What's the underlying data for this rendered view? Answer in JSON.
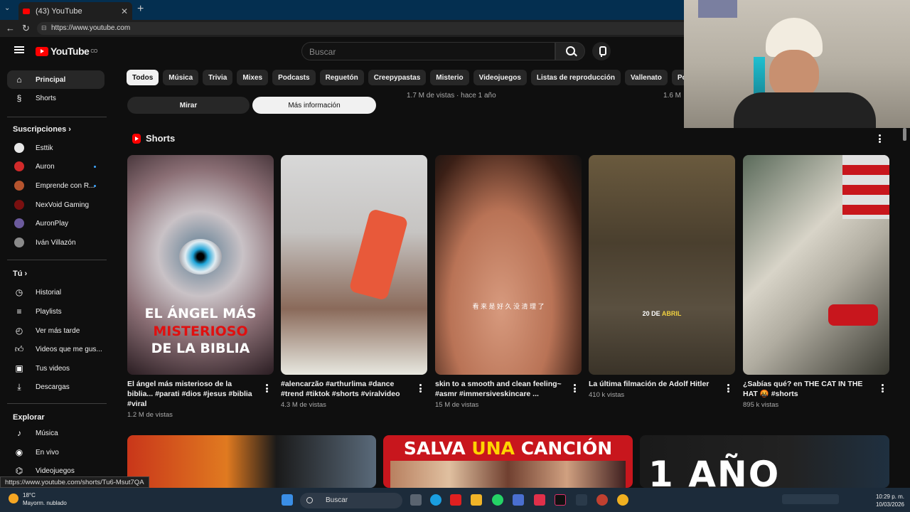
{
  "browser": {
    "tab_title": "(43) YouTube",
    "url": "https://www.youtube.com",
    "status_url": "https://www.youtube.com/shorts/Tu6-Msut7QA"
  },
  "header": {
    "logo_text": "YouTube",
    "country_code": "CO",
    "search_placeholder": "Buscar"
  },
  "sidebar": {
    "main": [
      {
        "label": "Principal",
        "icon": "home-icon"
      },
      {
        "label": "Shorts",
        "icon": "shorts-icon"
      }
    ],
    "subscriptions_heading": "Suscripciones",
    "subscriptions": [
      {
        "label": "Esttik"
      },
      {
        "label": "Auron"
      },
      {
        "label": "Emprende con R..."
      },
      {
        "label": "NexVoid Gaming"
      },
      {
        "label": "AuronPlay"
      },
      {
        "label": "Iván Villazón"
      }
    ],
    "you_heading": "Tú",
    "you_items": [
      {
        "label": "Historial",
        "icon": "history-icon"
      },
      {
        "label": "Playlists",
        "icon": "playlists-icon"
      },
      {
        "label": "Ver más tarde",
        "icon": "clock-icon"
      },
      {
        "label": "Videos que me gus...",
        "icon": "thumbs-up-icon"
      },
      {
        "label": "Tus videos",
        "icon": "video-icon"
      },
      {
        "label": "Descargas",
        "icon": "download-icon"
      }
    ],
    "explore_heading": "Explorar",
    "explore_items": [
      {
        "label": "Música",
        "icon": "music-icon"
      },
      {
        "label": "En vivo",
        "icon": "live-icon"
      },
      {
        "label": "Videojuegos",
        "icon": "gaming-icon"
      }
    ]
  },
  "chips": [
    "Todos",
    "Música",
    "Trivia",
    "Mixes",
    "Podcasts",
    "Reguetón",
    "Creepypastas",
    "Misterio",
    "Videojuegos",
    "Listas de reproducción",
    "Vallenato",
    "Pop latino"
  ],
  "ad": {
    "watch_label": "Mirar",
    "more_info_label": "Más información"
  },
  "top_meta": [
    "1.7 M de vistas · hace 1 año",
    "1.6 M"
  ],
  "shorts": {
    "heading": "Shorts",
    "items": [
      {
        "title": "El ángel más misterioso de la biblia... #parati #dios #jesus #biblia #viral",
        "views": "1.2 M de vistas",
        "overlay": [
          "EL ÁNGEL MÁS",
          "MISTERIOSO",
          "DE LA BIBLIA"
        ]
      },
      {
        "title": "#alencarzão #arthurlima #dance #trend #tiktok #shorts #viralvideo",
        "views": "4.3 M de vistas"
      },
      {
        "title": "skin to a smooth and clean feeling~ #asmr #immersiveskincare ...",
        "views": "15 M de vistas",
        "overlay": "看 来 是 好 久 没 清 理 了"
      },
      {
        "title": "La última filmación de Adolf Hitler",
        "views": "410 k vistas",
        "overlay": [
          "20 DE",
          "ABRIL"
        ]
      },
      {
        "title": "¿Sabías qué? en THE CAT IN THE HAT 🤬 #shorts",
        "views": "895 k vistas"
      }
    ]
  },
  "bottom_thumbs": {
    "middle_text": [
      "SALVA",
      "UNA",
      "CANCIÓN"
    ],
    "right_text": "1 AÑO"
  },
  "taskbar": {
    "temperature": "18°C",
    "weather": "Mayorm. nublado",
    "search": "Buscar",
    "time": "10:29 p. m.",
    "date": "10/03/2026"
  }
}
